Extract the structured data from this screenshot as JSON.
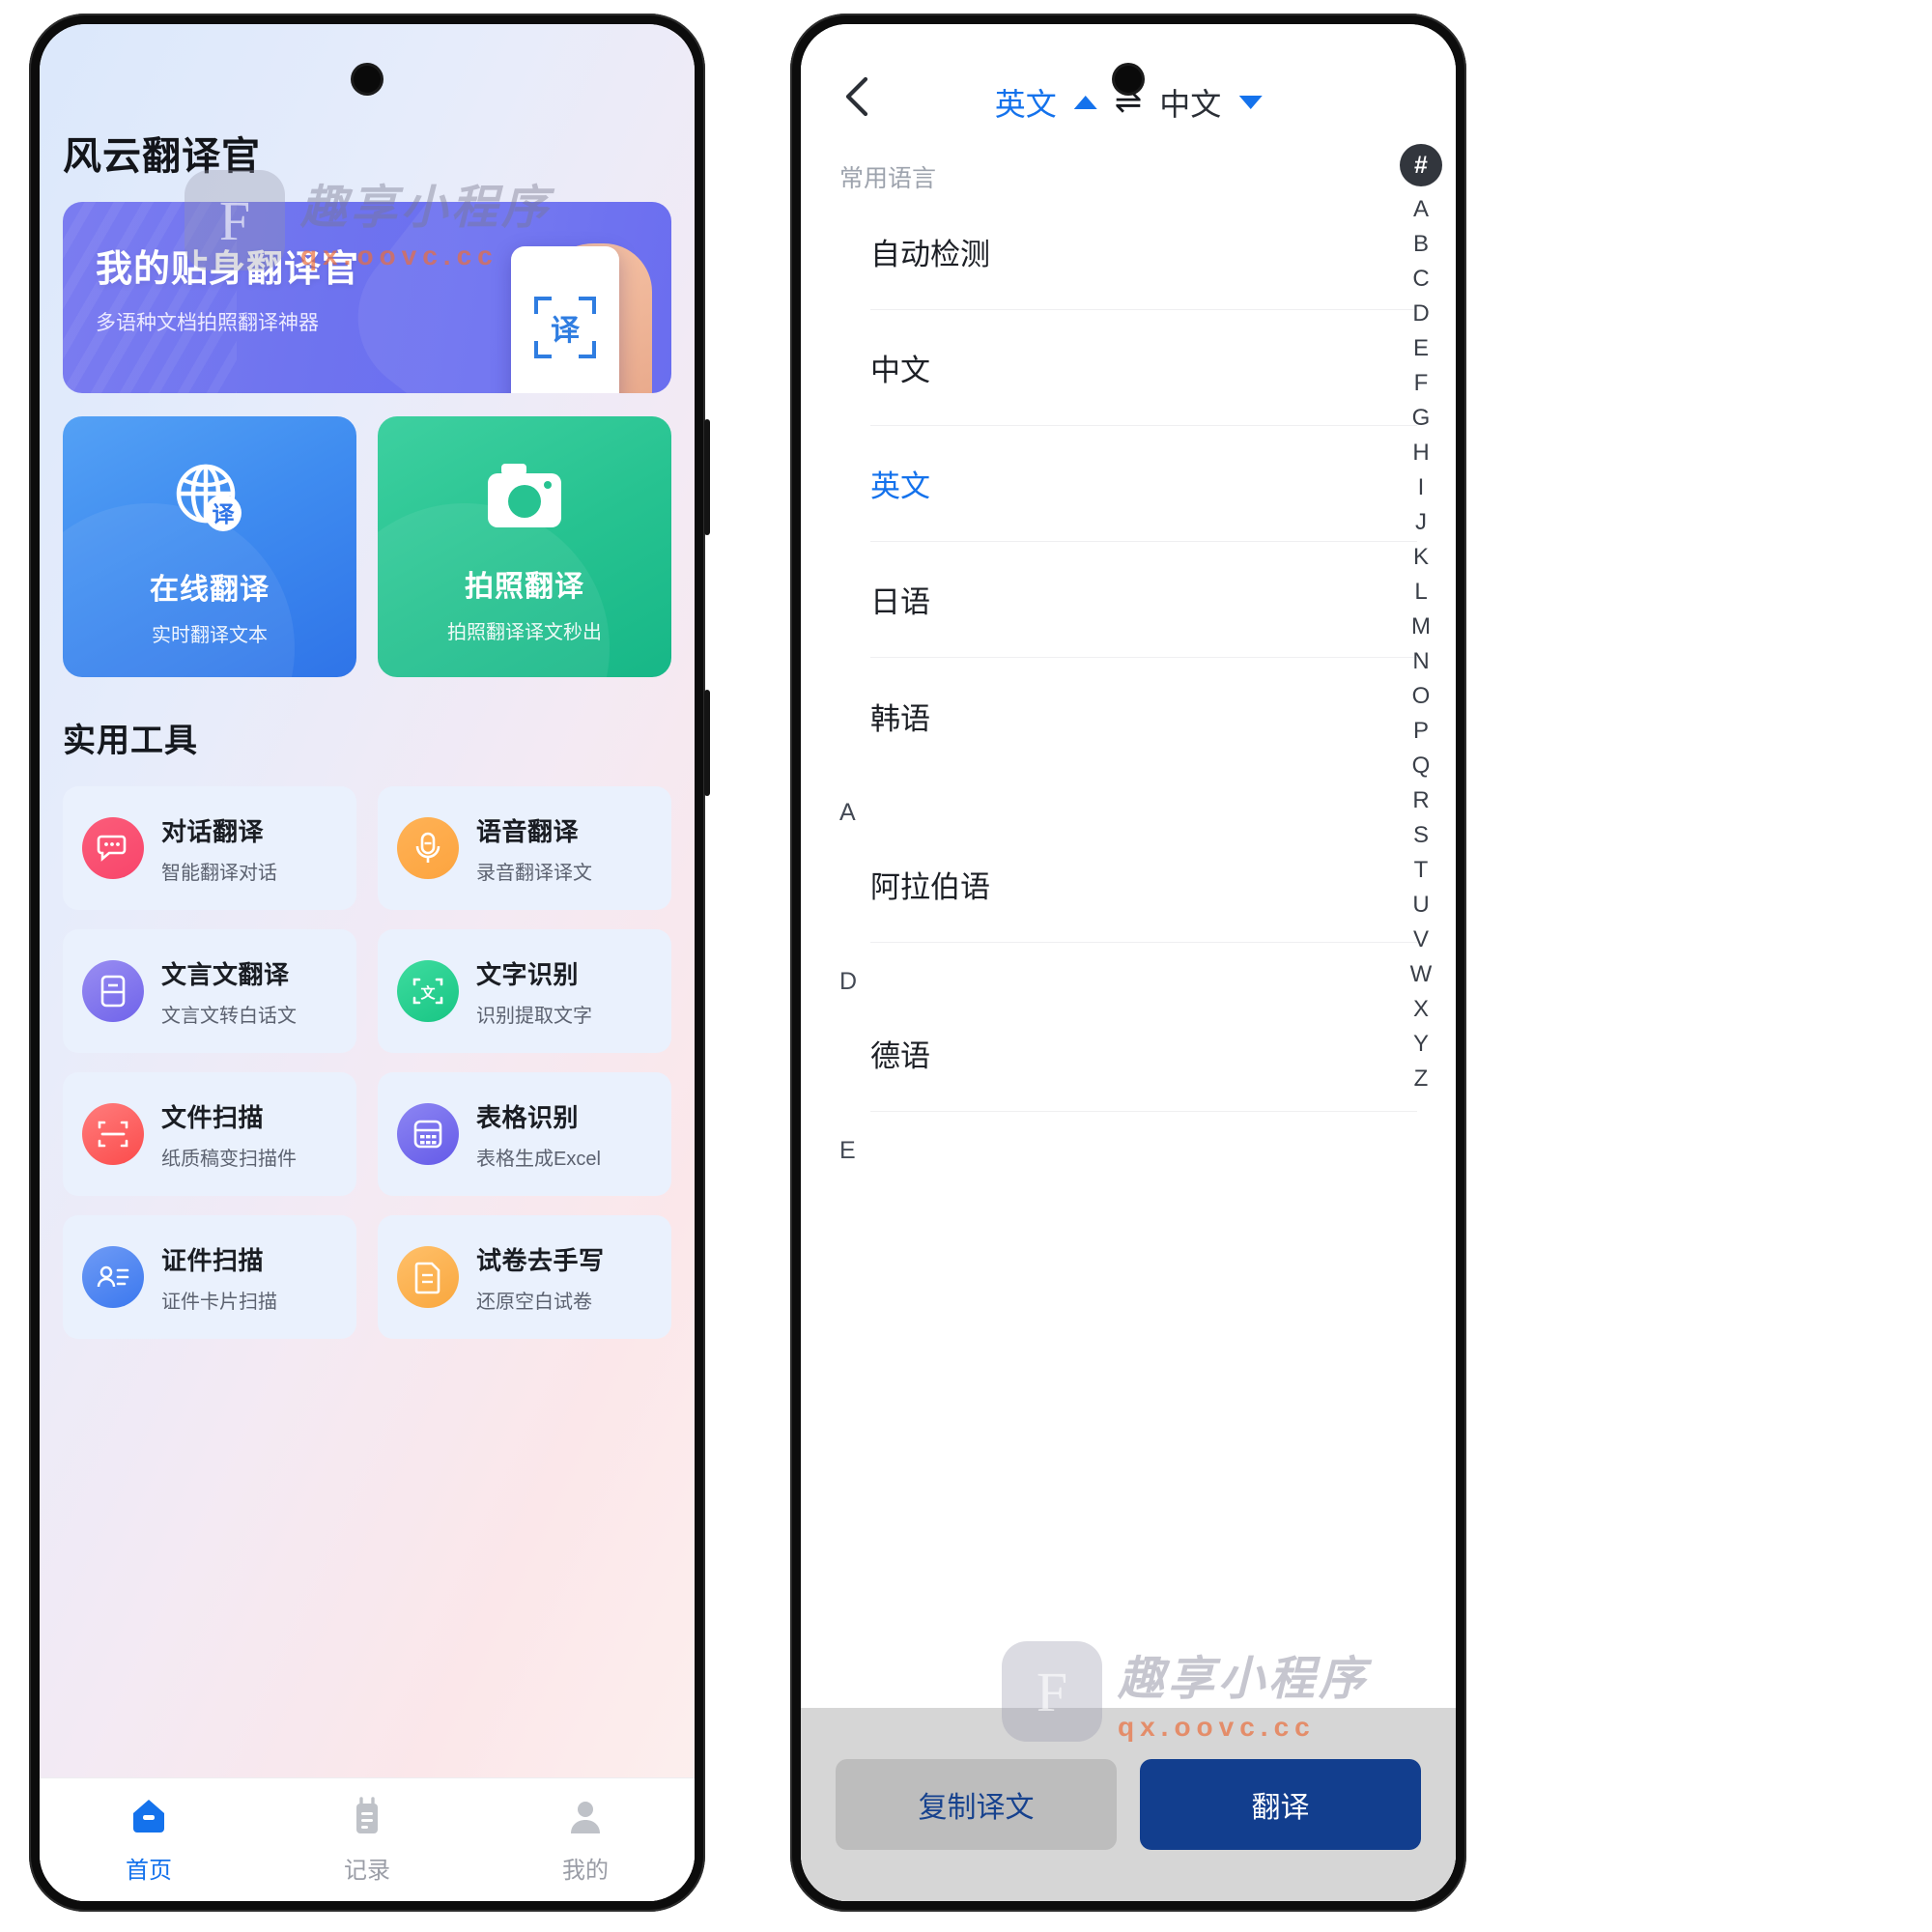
{
  "watermark": {
    "logo_letter": "F",
    "brand_cn": "趣享小程序",
    "url": "qx.oovc.cc"
  },
  "left_phone": {
    "app_title": "风云翻译官",
    "hero": {
      "title": "我的贴身翻译官",
      "subtitle": "多语种文档拍照翻译神器",
      "phone_icon_label": "译",
      "icon_name": "scan-translate-icon"
    },
    "big_cards": [
      {
        "title": "在线翻译",
        "subtitle": "实时翻译文本",
        "icon": "globe-translate-icon",
        "color": "#3f8cf0"
      },
      {
        "title": "拍照翻译",
        "subtitle": "拍照翻译译文秒出",
        "icon": "camera-icon",
        "color": "#27c391"
      }
    ],
    "tools_section_title": "实用工具",
    "tools": [
      {
        "name": "对话翻译",
        "desc": "智能翻译对话",
        "icon": "chat-bubbles-icon",
        "color1": "#fb5d7a",
        "color2": "#f8456b"
      },
      {
        "name": "语音翻译",
        "desc": "录音翻译译文",
        "icon": "microphone-icon",
        "color1": "#ffb256",
        "color2": "#fca43f"
      },
      {
        "name": "文言文翻译",
        "desc": "文言文转白话文",
        "icon": "book-icon",
        "color1": "#9a8ef2",
        "color2": "#6f63ea"
      },
      {
        "name": "文字识别",
        "desc": "识别提取文字",
        "icon": "ocr-scan-icon",
        "color1": "#3edc9f",
        "color2": "#18c584"
      },
      {
        "name": "文件扫描",
        "desc": "纸质稿变扫描件",
        "icon": "doc-scan-icon",
        "color1": "#ff7d7d",
        "color2": "#fb4b4b"
      },
      {
        "name": "表格识别",
        "desc": "表格生成Excel",
        "icon": "table-icon",
        "color1": "#8d86f3",
        "color2": "#645ae8"
      },
      {
        "name": "证件扫描",
        "desc": "证件卡片扫描",
        "icon": "id-card-icon",
        "color1": "#6f9bf5",
        "color2": "#3b78ef"
      },
      {
        "name": "试卷去手写",
        "desc": "还原空白试卷",
        "icon": "paper-icon",
        "color1": "#ffc06a",
        "color2": "#f9a73e"
      }
    ],
    "tabs": [
      {
        "label": "首页",
        "icon": "home-icon",
        "active": true
      },
      {
        "label": "记录",
        "icon": "records-icon",
        "active": false
      },
      {
        "label": "我的",
        "icon": "profile-icon",
        "active": false
      }
    ],
    "accent_color": "#1472ec"
  },
  "right_phone": {
    "header": {
      "back_icon": "chevron-left-icon",
      "source_lang": "英文",
      "target_lang": "中文",
      "swap_icon": "swap-horizontal-icon",
      "source_caret": "caret-up-icon",
      "target_caret": "caret-down-icon"
    },
    "common_section_title": "常用语言",
    "common_languages": [
      "自动检测",
      "中文",
      "英文",
      "日语",
      "韩语"
    ],
    "selected_language": "英文",
    "groups": [
      {
        "letter": "A",
        "items": [
          "阿拉伯语"
        ]
      },
      {
        "letter": "D",
        "items": [
          "德语"
        ]
      },
      {
        "letter": "E",
        "items": []
      }
    ],
    "alpha_index": {
      "current": "#",
      "letters": [
        "A",
        "B",
        "C",
        "D",
        "E",
        "F",
        "G",
        "H",
        "I",
        "J",
        "K",
        "L",
        "M",
        "N",
        "O",
        "P",
        "Q",
        "R",
        "S",
        "T",
        "U",
        "V",
        "W",
        "X",
        "Y",
        "Z"
      ]
    },
    "footer": {
      "copy_label": "复制译文",
      "translate_label": "翻译"
    },
    "accent_color": "#1472ec"
  }
}
